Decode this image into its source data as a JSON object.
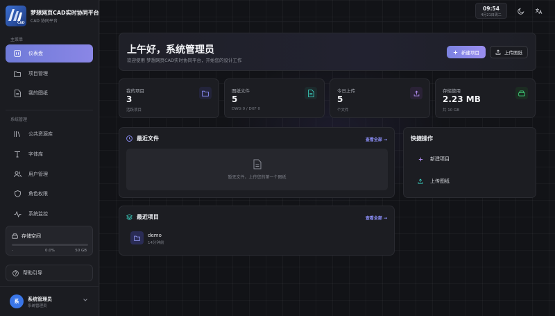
{
  "brand": {
    "title": "梦想网页CAD实时协同平台",
    "subtitle": "CAD 协同平台",
    "logo_badge": "CAD"
  },
  "sidebar": {
    "main_section_label": "主菜单",
    "main_items": [
      {
        "label": "仪表盘",
        "icon": "dashboard-icon",
        "active": true
      },
      {
        "label": "项目管理",
        "icon": "folder-icon",
        "active": false
      },
      {
        "label": "我的图纸",
        "icon": "document-icon",
        "active": false
      }
    ],
    "system_section_label": "系统管理",
    "system_items": [
      {
        "label": "公共资源库",
        "icon": "library-icon"
      },
      {
        "label": "字体库",
        "icon": "font-icon"
      },
      {
        "label": "用户管理",
        "icon": "users-icon"
      },
      {
        "label": "角色权限",
        "icon": "shield-icon"
      },
      {
        "label": "系统监控",
        "icon": "activity-icon"
      }
    ],
    "storage": {
      "title": "存储空间",
      "min_label": "-",
      "percent_label": "0.0%",
      "max_label": "50 GB",
      "fill_fraction": 0.0
    },
    "help_label": "帮助引导",
    "user": {
      "avatar_text": "系",
      "name": "系统管理员",
      "role": "系统管理员"
    }
  },
  "topbar": {
    "time": "09:54",
    "date": "4月21日周二",
    "theme_icon": "moon-icon",
    "translate_icon": "translate-icon"
  },
  "hero": {
    "title": "上午好，系统管理员",
    "subtitle": "欢迎使用 梦想网页CAD实时协同平台，开始您的设计工作",
    "new_project_label": "新建项目",
    "upload_label": "上传图纸"
  },
  "stats": [
    {
      "label": "我的项目",
      "value": "3",
      "sub": "活跃项目",
      "icon": "folder-icon",
      "color": "#8f92ff",
      "bg": "#23243a"
    },
    {
      "label": "图纸文件",
      "value": "5",
      "sub": "DWG 0 / DXF 0",
      "icon": "file-icon",
      "color": "#3ad0c0",
      "bg": "#1d2a2c"
    },
    {
      "label": "今日上传",
      "value": "5",
      "sub": "个文件",
      "icon": "upload-icon",
      "color": "#b08cf0",
      "bg": "#2a2236"
    },
    {
      "label": "存储使用",
      "value": "2.23 MB",
      "sub": "共 10 GB",
      "icon": "drive-icon",
      "color": "#3ed17a",
      "bg": "#1c2c22"
    }
  ],
  "recent_files": {
    "title": "最近文件",
    "view_all": "查看全部 →",
    "empty_text": "暂无文件，上传您的第一个图纸"
  },
  "quick_actions": {
    "title": "快捷操作",
    "items": [
      {
        "label": "新建项目",
        "icon": "plus-icon"
      },
      {
        "label": "上传图纸",
        "icon": "upload-icon"
      }
    ]
  },
  "recent_projects": {
    "title": "最近项目",
    "view_all": "查看全部 →",
    "items": [
      {
        "name": "demo",
        "time": "14分钟前"
      }
    ]
  }
}
